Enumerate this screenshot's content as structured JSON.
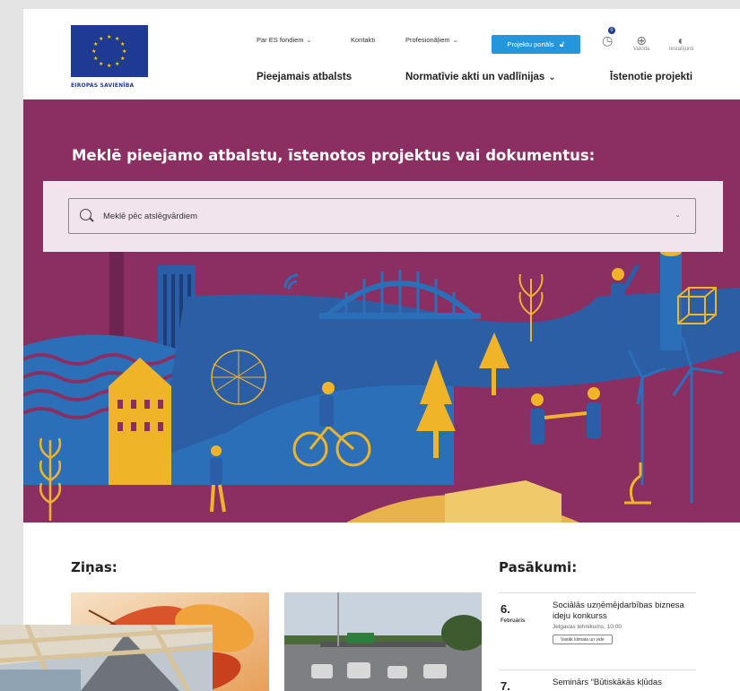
{
  "logo": {
    "text": "EIROPAS SAVIENĪBA"
  },
  "topnav": {
    "about_funds": "Par ES fondiem",
    "contacts": "Kontakti",
    "professionals": "Profesionāļiem",
    "portal_button": "Projektu portāls"
  },
  "mainnav": {
    "support": "Pieejamais atbalsts",
    "regulations": "Normatīvie akti un vadlīnijas",
    "projects": "Īstenotie projekti"
  },
  "utility": {
    "history_badge": "0",
    "language_label": "Valoda",
    "accessibility_label": "Iestatījumi"
  },
  "hero": {
    "title": "Meklē pieejamo atbalstu, īstenotos projektus vai dokumentus:",
    "search_placeholder": "Meklē pēc atslēgvārdiem"
  },
  "news": {
    "title": "Ziņas:"
  },
  "events": {
    "title": "Pasākumi:",
    "items": [
      {
        "day": "6.",
        "month": "Februāris",
        "title": "Sociālās uzņēmējdarbības biznesa ideju konkurss",
        "location": "Jelgavas tehnikums, 10:00",
        "button": "Vairāk klimata un vide"
      },
      {
        "day": "7.",
        "month": "",
        "title": "Seminārs “Būtiskākās kļūdas",
        "location": "",
        "button": ""
      }
    ]
  },
  "colors": {
    "hero_bg": "#8b2f63",
    "search_panel": "#f2e4ec",
    "portal_button": "#2496dd",
    "eu_blue": "#1f3a93",
    "accent_yellow": "#f0b429",
    "accent_blue": "#2a6fb8"
  }
}
